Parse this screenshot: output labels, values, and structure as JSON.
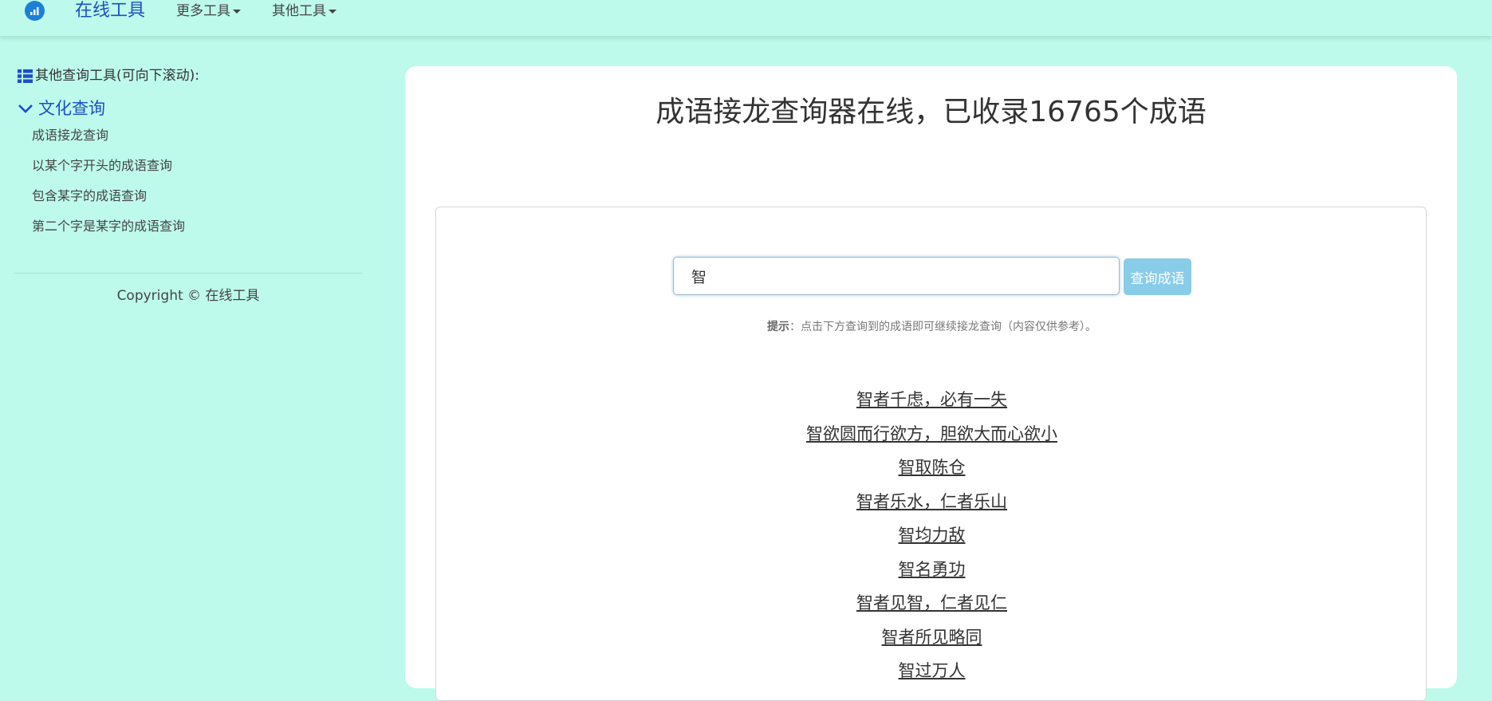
{
  "navbar": {
    "brand": "在线工具",
    "menus": [
      {
        "label": "更多工具"
      },
      {
        "label": "其他工具"
      }
    ]
  },
  "sidebar": {
    "header": "其他查询工具(可向下滚动):",
    "category": "文化查询",
    "links": [
      {
        "label": "成语接龙查询"
      },
      {
        "label": "以某个字开头的成语查询"
      },
      {
        "label": "包含某字的成语查询"
      },
      {
        "label": "第二个字是某字的成语查询"
      }
    ],
    "copyright": "Copyright © 在线工具"
  },
  "main": {
    "title": "成语接龙查询器在线，已收录16765个成语",
    "search": {
      "value": "智",
      "button_label": "查询成语"
    },
    "hint": {
      "label": "提示",
      "text": "：点击下方查询到的成语即可继续接龙查询（内容仅供参考）。"
    },
    "results": [
      "智者千虑，必有一失",
      "智欲圆而行欲方，胆欲大而心欲小",
      "智取陈仓",
      "智者乐水，仁者乐山",
      "智均力敌",
      "智名勇功",
      "智者见智，仁者见仁",
      "智者所见略同",
      "智过万人"
    ]
  },
  "colors": {
    "background": "#bdfaeb",
    "brand": "#1d4fc4",
    "button": "#89cce8"
  },
  "icons": {
    "logo": "chart-logo-icon",
    "sidebar_header": "list-icon",
    "category": "chevron-down-icon"
  }
}
